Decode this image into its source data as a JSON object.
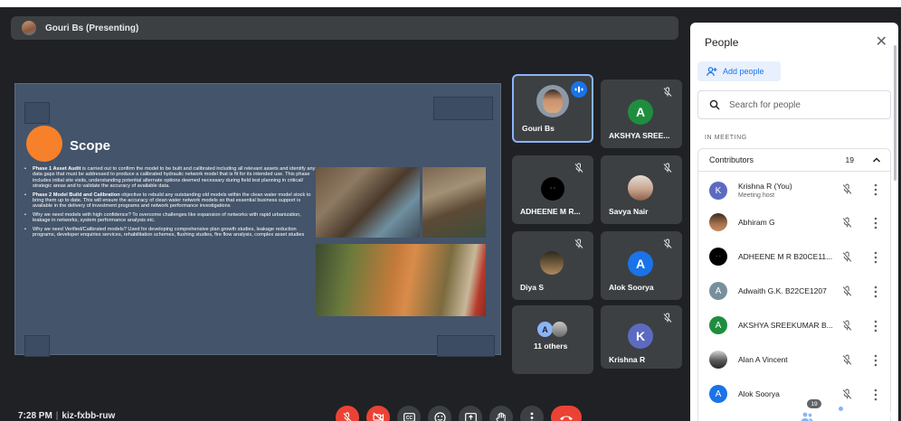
{
  "presenter": {
    "name": "Gouri Bs (Presenting)"
  },
  "slide": {
    "title": "Scope",
    "bullets": [
      {
        "lead": "Phase 1 Asset Audit",
        "text": " is carried out to confirm the model to be built and calibrated including all relevant assets and identify any data gaps that must be addressed to produce a calibrated hydraulic network model that is fit for its intended use. This phase includes initial site visits, understanding potential alternate options deemed necessary during field test planning in critical/ strategic areas and to validate the accuracy of available data."
      },
      {
        "lead": "Phase 2 Model Build  and Calibration",
        "text": " objective to rebuild any outstanding old models within the clean water model stock to bring them up to date. This will ensure the accuracy of clean water network models so that essential business support is available in the delivery of investment programs and network performance investigations"
      },
      {
        "lead": "",
        "text": "Why we need models with high confidence? To overcome challenges like expansion of networks with rapid urbanization, leakage in networks, system performance analysis etc."
      },
      {
        "lead": "",
        "text": "Why we need Verified/Calibrated models?  Used for developing comprehensive plan growth studies, leakage reduction programs, developer enquiries services, rehabilitation schemes, flushing studies, fire flow analysis, complex asset studies"
      }
    ]
  },
  "tiles": [
    {
      "label": "Gouri Bs"
    },
    {
      "label": "AKSHYA SREE...",
      "initial": "A"
    },
    {
      "label": "ADHEENE M R..."
    },
    {
      "label": "Savya Nair"
    },
    {
      "label": "Diya S"
    },
    {
      "label": "Alok Soorya",
      "initial": "A"
    },
    {
      "label": "11 others",
      "initial": "A"
    },
    {
      "label": "Krishna R",
      "initial": "K"
    }
  ],
  "sidebar": {
    "title": "People",
    "add_people": "Add people",
    "search_placeholder": "Search for people",
    "section": "IN MEETING",
    "group": "Contributors",
    "count": "19",
    "participants": [
      {
        "name": "Krishna R (You)",
        "sub": "Meeting host",
        "initial": "K"
      },
      {
        "name": "Abhiram G"
      },
      {
        "name": "ADHEENE M R B20CE11..."
      },
      {
        "name": "Adwaith G.K. B22CE1207",
        "initial": "A"
      },
      {
        "name": "AKSHYA SREEKUMAR B...",
        "initial": "A"
      },
      {
        "name": "Alan A Vincent"
      },
      {
        "name": "Alok Soorya",
        "initial": "A"
      }
    ]
  },
  "bottom": {
    "time": "7:28 PM",
    "sep": "|",
    "code": "kiz-fxbb-ruw",
    "people_badge": "19"
  },
  "colors": {
    "background": "#202124",
    "tile": "#3c4043",
    "danger": "#ea4335",
    "accent": "#1a73e8",
    "green": "#1e8e3e",
    "alok_blue": "#1a73e8",
    "krishna_purple": "#5c6bc0",
    "slide_bg": "#44546a"
  }
}
